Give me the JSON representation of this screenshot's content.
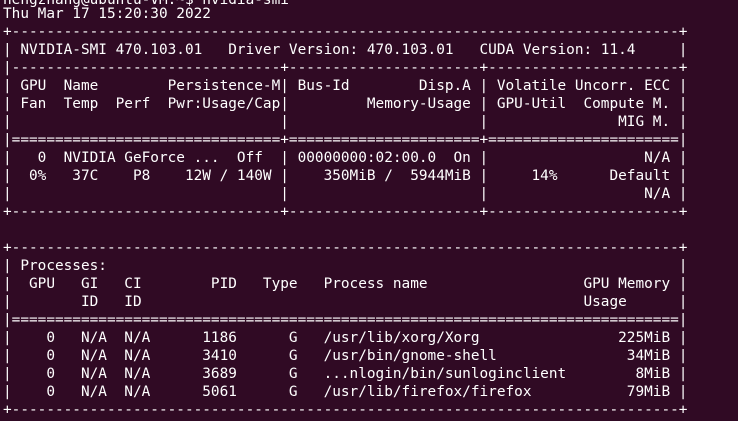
{
  "colors": {
    "background": "#300a24",
    "foreground": "#ffffff"
  },
  "terminal": {
    "prompt_partial": "nengzhang@ubuntu-VM:~$ nvidia-smi",
    "lines": [
      "Thu Mar 17 15:20:30 2022",
      "+-----------------------------------------------------------------------------+",
      "| NVIDIA-SMI 470.103.01   Driver Version: 470.103.01   CUDA Version: 11.4     |",
      "|-------------------------------+----------------------+----------------------+",
      "| GPU  Name        Persistence-M| Bus-Id        Disp.A | Volatile Uncorr. ECC |",
      "| Fan  Temp  Perf  Pwr:Usage/Cap|         Memory-Usage | GPU-Util  Compute M. |",
      "|                               |                      |               MIG M. |",
      "|===============================+======================+======================|",
      "|   0  NVIDIA GeForce ...  Off  | 00000000:02:00.0  On |                  N/A |",
      "|  0%   37C    P8    12W / 140W |    350MiB /  5944MiB |     14%      Default |",
      "|                               |                      |                  N/A |",
      "+-------------------------------+----------------------+----------------------+",
      "",
      "+-----------------------------------------------------------------------------+",
      "| Processes:                                                                  |",
      "|  GPU   GI   CI        PID   Type   Process name                  GPU Memory |",
      "|        ID   ID                                                   Usage      |",
      "|=============================================================================|",
      "|    0   N/A  N/A      1186      G   /usr/lib/xorg/Xorg                225MiB |",
      "|    0   N/A  N/A      3410      G   /usr/bin/gnome-shell               34MiB |",
      "|    0   N/A  N/A      3689      G   ...nlogin/bin/sunloginclient        8MiB |",
      "|    0   N/A  N/A      5061      G   /usr/lib/firefox/firefox           79MiB |",
      "+-----------------------------------------------------------------------------+"
    ]
  }
}
